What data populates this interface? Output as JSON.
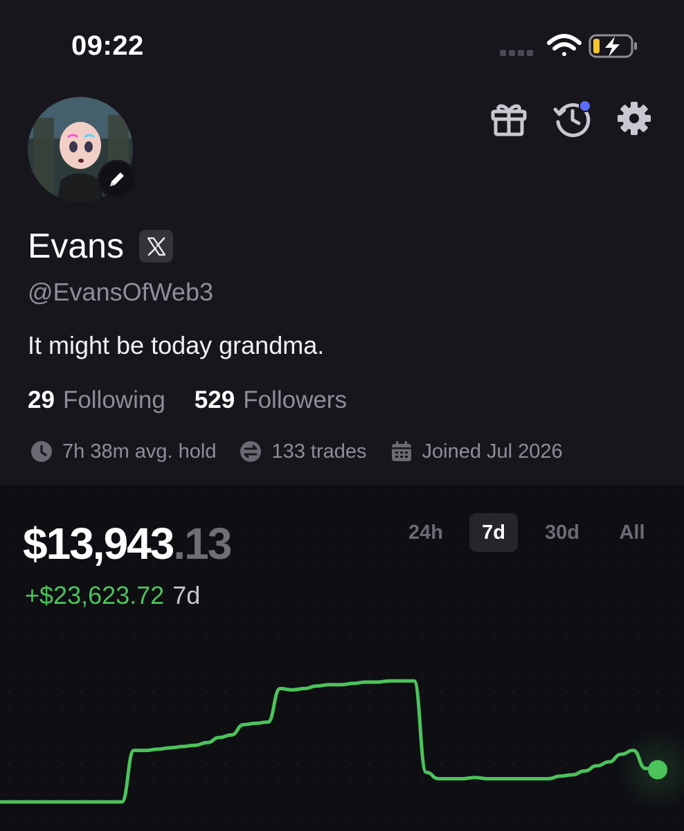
{
  "status_bar": {
    "time": "09:22"
  },
  "profile": {
    "name": "Evans",
    "handle": "@EvansOfWeb3",
    "bio": "It might be today grandma.",
    "following_count": "29",
    "following_label": "Following",
    "followers_count": "529",
    "followers_label": "Followers",
    "avg_hold": "7h 38m avg. hold",
    "trades": "133 trades",
    "joined": "Joined Jul 2026"
  },
  "portfolio": {
    "balance_main": "$13,943",
    "balance_cents": ".13",
    "change_value": "+$23,623.72",
    "change_period": "7d"
  },
  "range_tabs": [
    {
      "label": "24h",
      "active": false
    },
    {
      "label": "7d",
      "active": true
    },
    {
      "label": "30d",
      "active": false
    },
    {
      "label": "All",
      "active": false
    }
  ],
  "icons": {
    "gift": "gift-icon",
    "history": "history-icon",
    "settings": "gear-icon",
    "edit": "pencil-icon",
    "x_badge": "x-logo-icon",
    "signal": "cellular-signal-icon",
    "wifi": "wifi-icon",
    "battery": "battery-charging-icon"
  },
  "colors": {
    "background": "#17161d",
    "chart_panel": "#0e0e13",
    "positive": "#4cc35b",
    "notification_dot": "#5b6cff",
    "battery_low": "#f3c330"
  },
  "chart_data": {
    "type": "line",
    "period": "7d",
    "x_label": "",
    "y_label": "",
    "series": [
      {
        "values": [
          0.0,
          0.0,
          0.0,
          0.0,
          0.0,
          0.0,
          0.0,
          0.0,
          0.0,
          0.0,
          0.0,
          0.4,
          0.4,
          0.41,
          0.42,
          0.43,
          0.44,
          0.46,
          0.5,
          0.52,
          0.6,
          0.61,
          0.62,
          0.88,
          0.87,
          0.88,
          0.9,
          0.91,
          0.91,
          0.92,
          0.93,
          0.93,
          0.94,
          0.94,
          0.94,
          0.23,
          0.18,
          0.18,
          0.18,
          0.19,
          0.18,
          0.18,
          0.18,
          0.18,
          0.18,
          0.18,
          0.2,
          0.21,
          0.24,
          0.28,
          0.31,
          0.37,
          0.4,
          0.26,
          0.25
        ]
      }
    ]
  }
}
